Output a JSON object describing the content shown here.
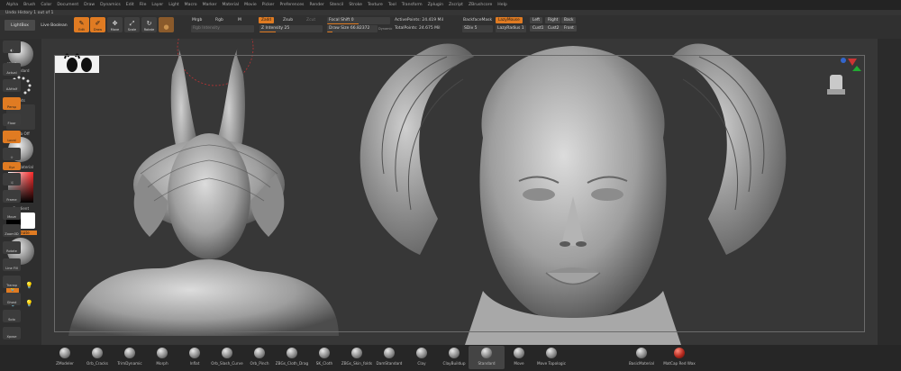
{
  "menubar": {
    "items": [
      "Alpha",
      "Brush",
      "Color",
      "Document",
      "Draw",
      "Dynamics",
      "Edit",
      "File",
      "Layer",
      "Light",
      "Macro",
      "Marker",
      "Material",
      "Movie",
      "Picker",
      "Preferences",
      "Render",
      "Stencil",
      "Stroke",
      "Texture",
      "Tool",
      "Transform",
      "Zplugin",
      "Zscript",
      "ZBrushcore",
      "Help"
    ]
  },
  "undo_history": "Undo History 1 out of 1",
  "toolbar": {
    "lightbox": "LightBox",
    "live_boolean": "Live Boolean",
    "edit": "Edit",
    "draw": "Draw",
    "move": "Move",
    "scale": "Scale",
    "rotate": "Rotate",
    "mrgb": "Mrgb",
    "rgb": "Rgb",
    "m": "M",
    "zadd": "Zadd",
    "zsub": "Zsub",
    "zcut": "Zcut",
    "rgb_intensity": "Rgb Intensity",
    "z_intensity": "Z Intensity 25",
    "focal_shift": "Focal Shift 0",
    "draw_size": "Draw Size 66.82372",
    "dynamic": "Dynamic",
    "active_points": "ActivePoints: 24.419 Mil",
    "total_points": "TotalPoints: 24.675 Mil",
    "backface_mask": "BackfaceMask",
    "lazymouse": "LazyMouse",
    "sdiv": "SDiv 5",
    "lazyradius": "LazyRadius 1",
    "left": "Left",
    "right": "Right",
    "back": "Back",
    "cust1": "Cust1",
    "cust2": "Cust2",
    "front": "Front"
  },
  "leftshelf": {
    "standard": "Standard",
    "dots": "Dots",
    "alpha_off": "Alpha Off",
    "basic_material": "BasicMaterial",
    "gradient": "Gradient",
    "alternate": "Alternate"
  },
  "rightshelf": {
    "spix": "SPix 3",
    "actual": "Actual",
    "aahalf": "AAHalf",
    "persp": "Persp",
    "floor": "Floor",
    "local": "Local",
    "xyz": "Xyz",
    "frame": "Frame",
    "move": "Move",
    "zoom3d": "Zoom3D",
    "rotate": "Rotate",
    "line_fill": "Line Fill",
    "transp": "Transp",
    "ghost": "Ghost",
    "solo": "Solo",
    "xpose": "Xpose"
  },
  "bottomshelf": {
    "brushes": [
      "ZModeler",
      "Orb_Cracks",
      "TrimDynamic",
      "Morph",
      "Inflat",
      "Orb_Slash_Curve",
      "Orb_Pinch",
      "ZBGs_Cloth_Drag",
      "SK_Cloth",
      "ZBGs_Skin_folds",
      "DamStandard",
      "Clay",
      "ClayBuildup",
      "Standard",
      "Move",
      "Move Topologic"
    ],
    "material": "BasicMaterial",
    "matcap": "MatCap Red Wax"
  },
  "colors": {
    "accent": "#e07b22"
  }
}
